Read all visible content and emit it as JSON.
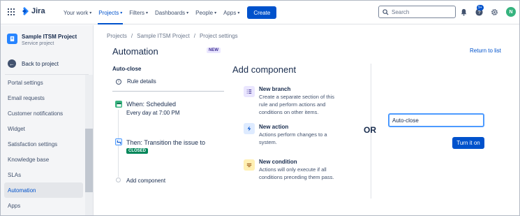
{
  "topnav": {
    "app_name": "Jira",
    "menu": [
      {
        "label": "Your work"
      },
      {
        "label": "Projects"
      },
      {
        "label": "Filters"
      },
      {
        "label": "Dashboards"
      },
      {
        "label": "People"
      },
      {
        "label": "Apps"
      }
    ],
    "active_menu": "Projects",
    "create_label": "Create",
    "search_placeholder": "Search",
    "help_badge": "9+",
    "avatar_initial": "N",
    "icons": [
      "app-switcher-icon",
      "notifications-icon",
      "help-icon",
      "settings-icon"
    ]
  },
  "sidebar": {
    "project_name": "Sample ITSM Project",
    "project_type": "Service project",
    "back_label": "Back to project",
    "items": [
      {
        "label": "Portal settings"
      },
      {
        "label": "Email requests"
      },
      {
        "label": "Customer notifications"
      },
      {
        "label": "Widget"
      },
      {
        "label": "Satisfaction settings"
      },
      {
        "label": "Knowledge base"
      },
      {
        "label": "SLAs"
      },
      {
        "label": "Automation"
      },
      {
        "label": "Apps"
      }
    ],
    "active_item": "Automation"
  },
  "breadcrumb": [
    "Projects",
    "Sample ITSM Project",
    "Project settings"
  ],
  "breadcrumb_separator": "/",
  "page": {
    "title": "Automation",
    "new_badge": "NEW",
    "return_link": "Return to list"
  },
  "rule": {
    "name": "Auto-close",
    "details_label": "Rule details",
    "trigger_title": "When: Scheduled",
    "trigger_sub": "Every day at 7:00 PM",
    "action_title": "Then: Transition the issue to",
    "status_lozenge": "CLOSED",
    "add_component": "Add component"
  },
  "add_component": {
    "title": "Add component",
    "options": [
      {
        "title": "New branch",
        "desc": "Create a separate section of this rule and perform actions and conditions on other items.",
        "icon": "branch-icon",
        "color": "#eae6ff"
      },
      {
        "title": "New action",
        "desc": "Actions perform changes to a system.",
        "icon": "lightning-icon",
        "color": "#deebff"
      },
      {
        "title": "New condition",
        "desc": "Actions will only execute if all conditions preceding them pass.",
        "icon": "condition-icon",
        "color": "#fff0b3"
      }
    ]
  },
  "or_label": "OR",
  "name_field_value": "Auto-close",
  "turn_on_label": "Turn it on",
  "colors": {
    "accent": "#0052cc",
    "closed": "#00875a",
    "when": "#36b37e"
  }
}
